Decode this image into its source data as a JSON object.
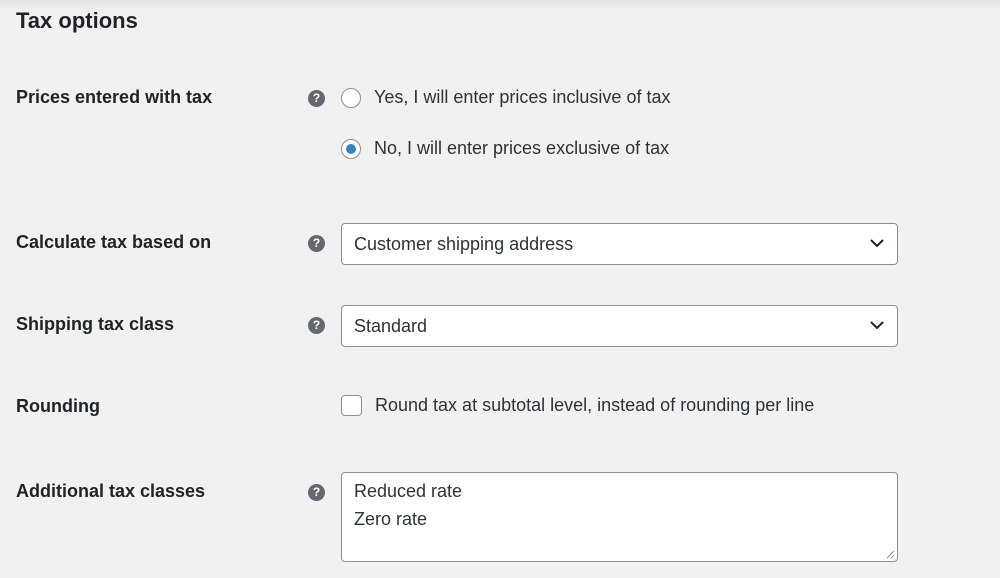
{
  "section": {
    "title": "Tax options"
  },
  "prices_entered_with_tax": {
    "label": "Prices entered with tax",
    "help_icon": "question-circle-icon",
    "options": [
      {
        "label": "Yes, I will enter prices inclusive of tax",
        "checked": false
      },
      {
        "label": "No, I will enter prices exclusive of tax",
        "checked": true
      }
    ]
  },
  "calculate_tax_based_on": {
    "label": "Calculate tax based on",
    "help_icon": "question-circle-icon",
    "selected": "Customer shipping address"
  },
  "shipping_tax_class": {
    "label": "Shipping tax class",
    "help_icon": "question-circle-icon",
    "selected": "Standard"
  },
  "rounding": {
    "label": "Rounding",
    "checkbox_label": "Round tax at subtotal level, instead of rounding per line",
    "checked": false
  },
  "additional_tax_classes": {
    "label": "Additional tax classes",
    "help_icon": "question-circle-icon",
    "lines": [
      "Reduced rate",
      "Zero rate"
    ]
  },
  "colors": {
    "background": "#f1f1f1",
    "text": "#1d2327",
    "border": "#8c8f94",
    "radio_accent": "#3582c4",
    "help_icon": "#646970"
  }
}
